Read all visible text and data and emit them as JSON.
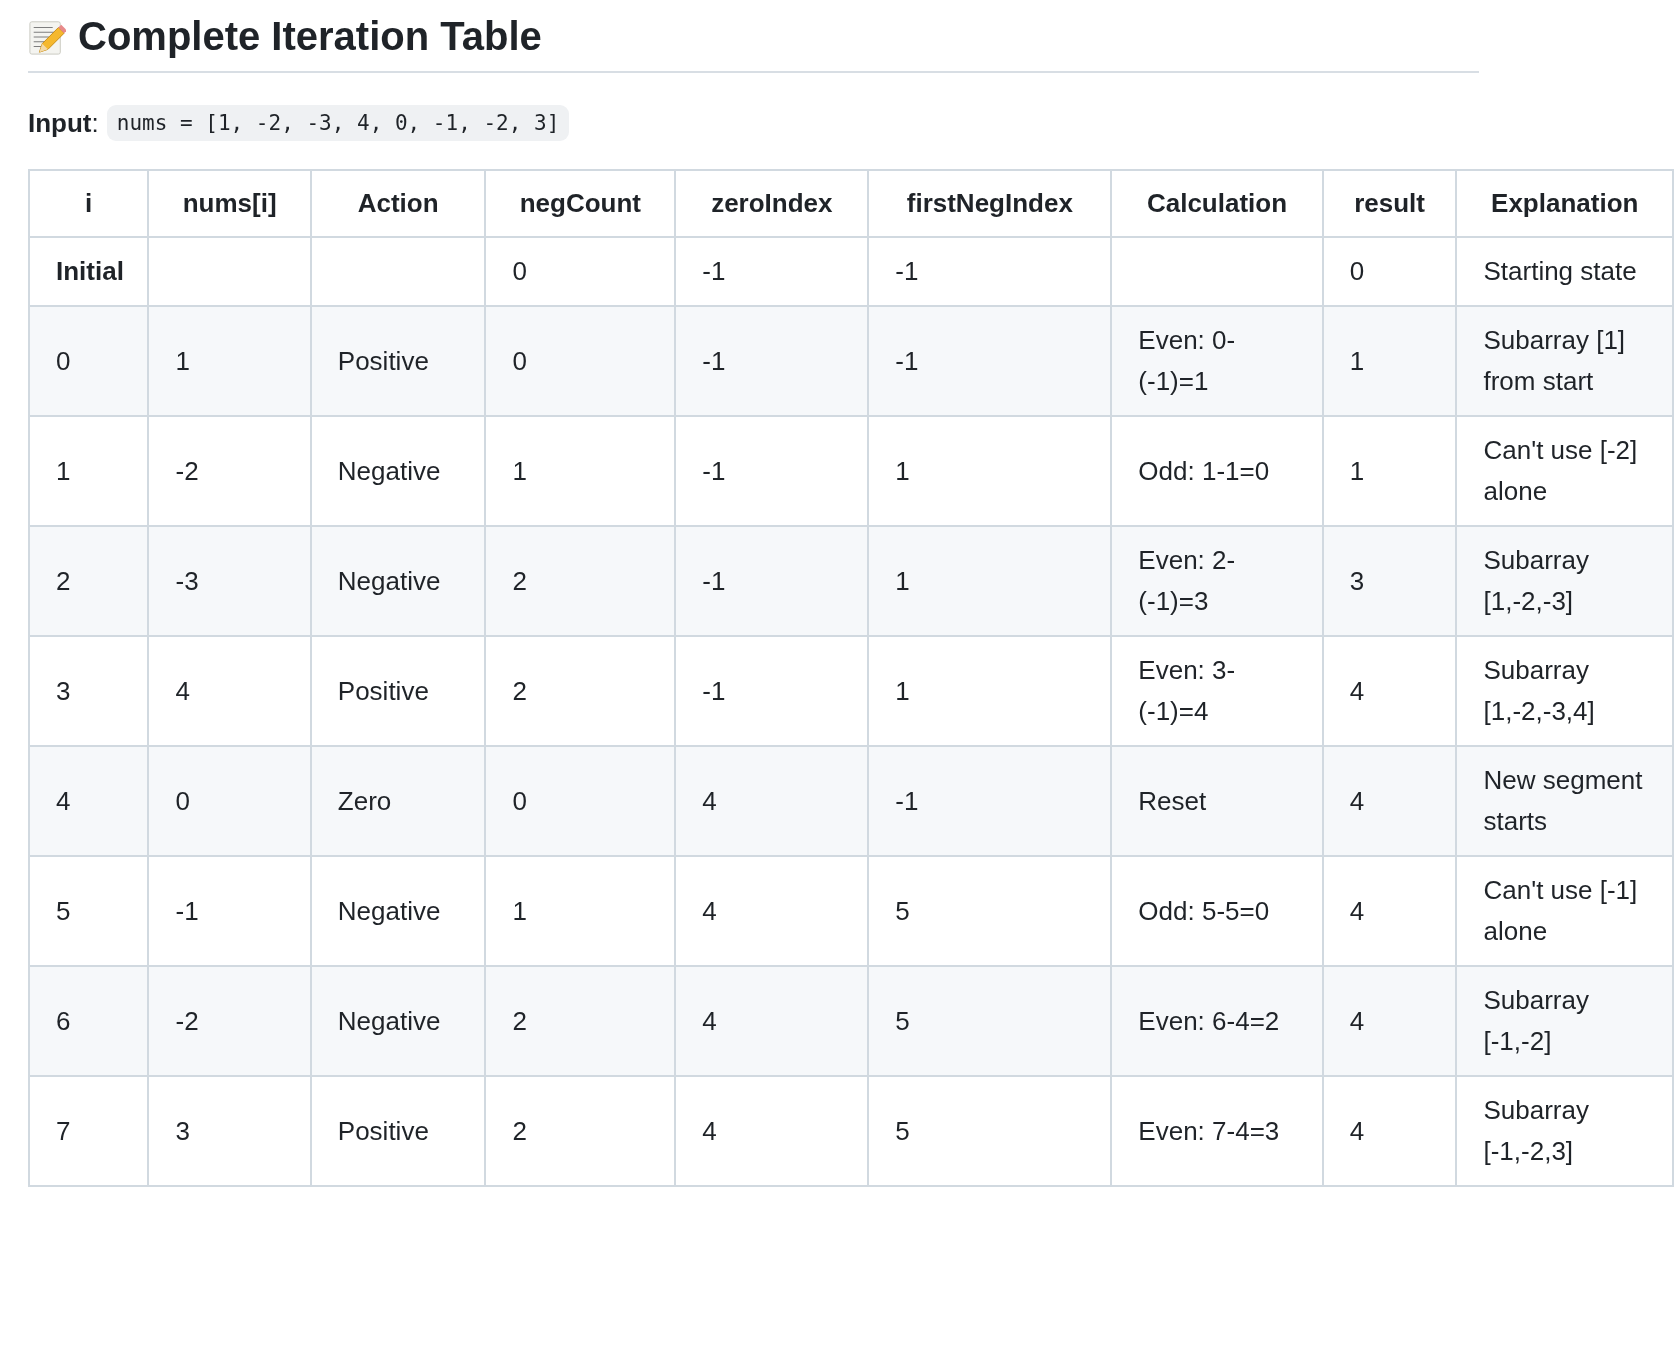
{
  "heading": "Complete Iteration Table",
  "input": {
    "label": "**Input**:",
    "code": "nums = [1, -2, -3, 4, 0, -1, -2, 3]"
  },
  "table": {
    "columns": [
      "i",
      "nums[i]",
      "Action",
      "negCount",
      "zeroIndex",
      "firstNegIndex",
      "Calculation",
      "result",
      "Explanation"
    ],
    "rows": [
      {
        "kind": "initial",
        "cells": [
          "Initial",
          "",
          "",
          "0",
          "-1",
          "-1",
          "",
          "0",
          "Starting state"
        ]
      },
      {
        "kind": "step",
        "cells": [
          "0",
          "1",
          "Positive",
          "0",
          "-1",
          "-1",
          "Even: 0-(-1)=1",
          "1",
          "Subarray [1] from start"
        ]
      },
      {
        "kind": "step",
        "cells": [
          "1",
          "-2",
          "Negative",
          "1",
          "-1",
          "1",
          "Odd: 1-1=0",
          "1",
          "Can't use [-2] alone"
        ]
      },
      {
        "kind": "step",
        "cells": [
          "2",
          "-3",
          "Negative",
          "2",
          "-1",
          "1",
          "Even: 2-(-1)=3",
          "3",
          "Subarray [1,-2,-3]"
        ]
      },
      {
        "kind": "step",
        "cells": [
          "3",
          "4",
          "Positive",
          "2",
          "-1",
          "1",
          "Even: 3-(-1)=4",
          "4",
          "Subarray [1,-2,-3,4]"
        ]
      },
      {
        "kind": "step",
        "cells": [
          "4",
          "0",
          "Zero",
          "0",
          "4",
          "-1",
          "Reset",
          "4",
          "New segment starts"
        ]
      },
      {
        "kind": "step",
        "cells": [
          "5",
          "-1",
          "Negative",
          "1",
          "4",
          "5",
          "Odd: 5-5=0",
          "4",
          "Can't use [-1] alone"
        ]
      },
      {
        "kind": "step",
        "cells": [
          "6",
          "-2",
          "Negative",
          "2",
          "4",
          "5",
          "Even: 6-4=2",
          "4",
          "Subarray [-1,-2]"
        ]
      },
      {
        "kind": "step",
        "cells": [
          "7",
          "3",
          "Positive",
          "2",
          "4",
          "5",
          "Even: 7-4=3",
          "4",
          "Subarray [-1,-2,3]"
        ]
      }
    ]
  }
}
